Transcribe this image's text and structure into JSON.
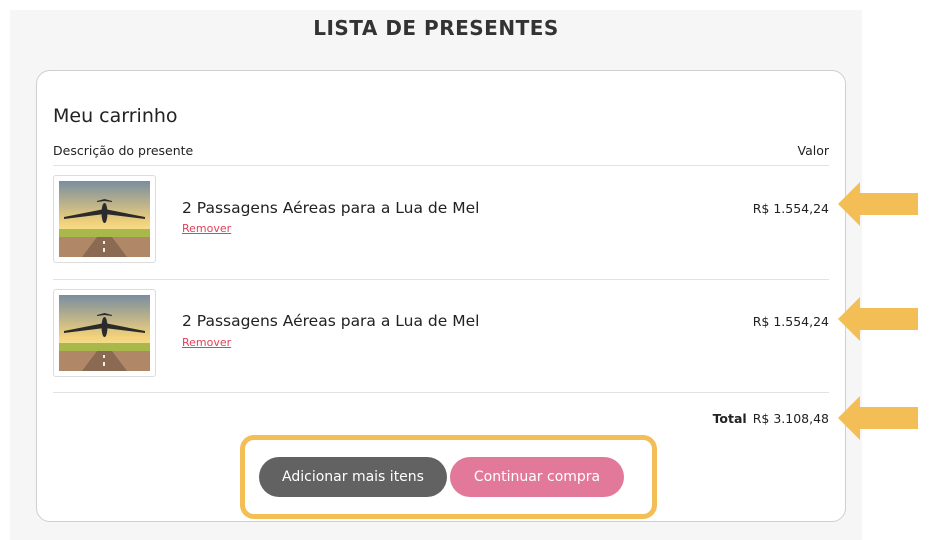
{
  "page": {
    "title": "LISTA DE PRESENTES"
  },
  "cart": {
    "heading": "Meu carrinho",
    "columns": {
      "description": "Descrição do presente",
      "value": "Valor"
    },
    "items": [
      {
        "name": "2 Passagens Aéreas para a Lua de Mel",
        "remove_label": "Remover",
        "price": "R$ 1.554,24",
        "image": "airplane-takeoff-image"
      },
      {
        "name": "2 Passagens Aéreas para a Lua de Mel",
        "remove_label": "Remover",
        "price": "R$ 1.554,24",
        "image": "airplane-takeoff-image"
      }
    ],
    "total": {
      "label": "Total",
      "value": "R$ 3.108,48"
    },
    "buttons": {
      "add_more": "Adicionar mais itens",
      "continue": "Continuar compra"
    }
  },
  "annotations": {
    "arrow_icon": "arrow-left-icon",
    "highlight_color": "#f2be55",
    "arrow_color": "#f2be55"
  },
  "colors": {
    "remove_link": "#e0425a",
    "button_secondary": "#626262",
    "button_primary": "#e2799b"
  }
}
